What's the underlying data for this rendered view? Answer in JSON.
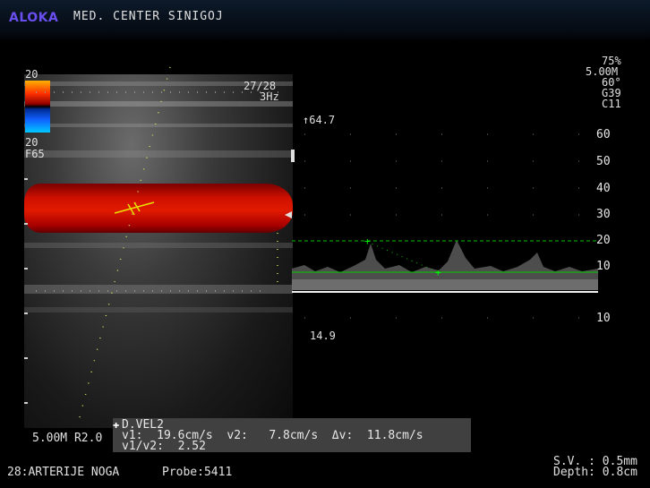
{
  "header": {
    "brand": "ALOKA",
    "facility": "MED. CENTER SINIGOJ"
  },
  "color_box": {
    "scale_top": "20",
    "scale_bottom": "20",
    "filter": "F65",
    "frame_rate": "27/28",
    "frequency": "3Hz"
  },
  "bmode": {
    "depth_probe": "5.00M R2.0"
  },
  "doppler": {
    "peak_label": "64.7",
    "lower_label": "14.9",
    "scale_ticks": [
      "60",
      "50",
      "40",
      "30",
      "20",
      "10",
      "10"
    ]
  },
  "settings": {
    "power": "75%",
    "freq": "5.00M",
    "angle": "60°",
    "gain": "G39",
    "contrast": "C11"
  },
  "measurement": {
    "title": "D.VEL2",
    "row1": "v1:  19.6cm/s  v2:   7.8cm/s  Δv:  11.8cm/s",
    "row2": "v1/v2:  2.52"
  },
  "footer": {
    "preset": "28:ARTERIJE NOGA",
    "probe": "Probe:5411",
    "sample_volume": "S.V. : 0.5mm",
    "depth": "Depth: 0.8cm"
  },
  "colors": {
    "brand": "#6a4ff0",
    "flow_red": "#e01a00",
    "caliper": "#00ff00",
    "measure_yellow": "#e8e000"
  }
}
